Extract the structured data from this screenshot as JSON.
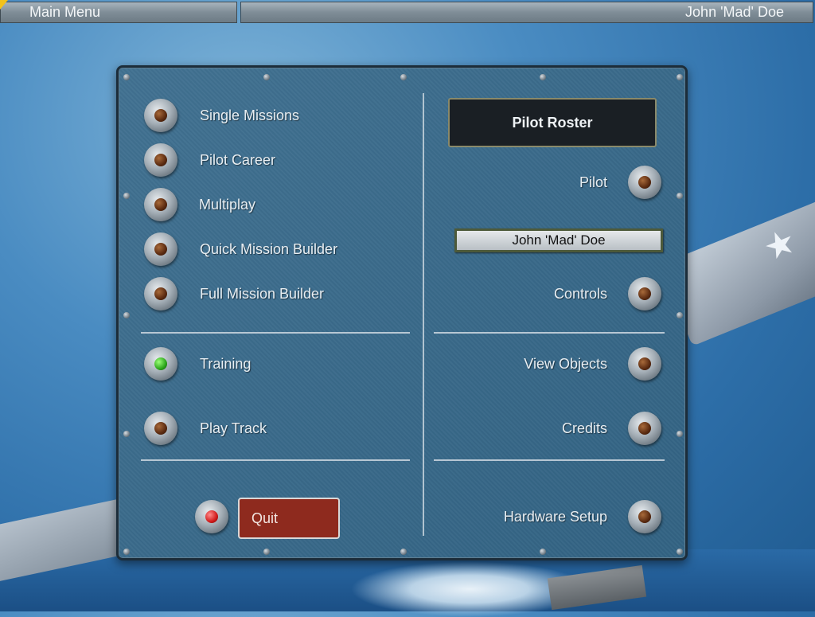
{
  "topbar": {
    "menu_title": "Main Menu",
    "current_pilot": "John 'Mad' Doe"
  },
  "left_menu": {
    "items": [
      {
        "label": "Single Missions",
        "state": "off"
      },
      {
        "label": "Pilot Career",
        "state": "off"
      },
      {
        "label": "Multiplay",
        "state": "off"
      },
      {
        "label": "Quick Mission Builder",
        "state": "off"
      },
      {
        "label": "Full Mission Builder",
        "state": "off"
      },
      {
        "label": "Training",
        "state": "active"
      },
      {
        "label": "Play Track",
        "state": "off"
      }
    ],
    "quit_label": "Quit"
  },
  "right_menu": {
    "roster_title": "Pilot Roster",
    "pilot_label": "Pilot",
    "pilot_value": "John 'Mad' Doe",
    "controls_label": "Controls",
    "view_objects_label": "View Objects",
    "credits_label": "Credits",
    "hardware_setup_label": "Hardware Setup"
  },
  "colors": {
    "panel": "#35688a",
    "quit_button": "#8e2a1e",
    "active_light": "#2ba61a",
    "quit_light": "#d01a1a"
  },
  "icons": [
    "cursor-arrow-icon",
    "amber-indicator-light",
    "green-indicator-light",
    "red-indicator-light"
  ]
}
